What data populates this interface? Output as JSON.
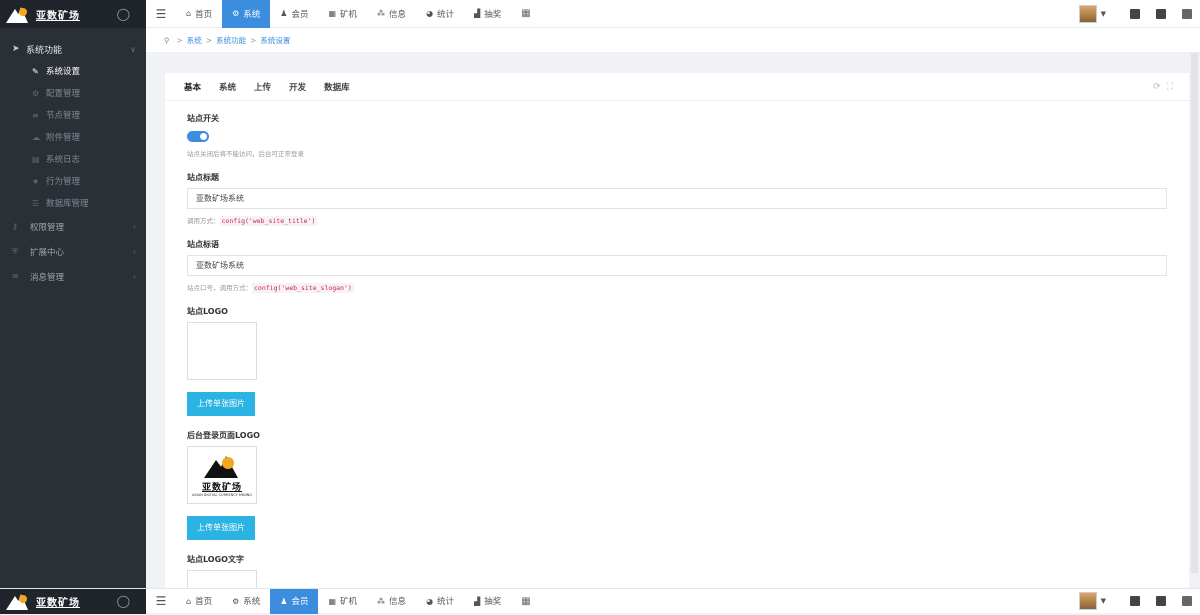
{
  "brand": {
    "name": "亚数矿场",
    "logo_tagline": "ASIAN DIGITAL CURRENCY MINING"
  },
  "sidebar": {
    "group_title": "系统功能",
    "sub_items": [
      {
        "label": "系统设置",
        "icon": "wrench-icon",
        "active": true
      },
      {
        "label": "配置管理",
        "icon": "gears-icon"
      },
      {
        "label": "节点管理",
        "icon": "list-icon"
      },
      {
        "label": "附件管理",
        "icon": "cloud-icon"
      },
      {
        "label": "系统日志",
        "icon": "file-icon"
      },
      {
        "label": "行为管理",
        "icon": "star-icon"
      },
      {
        "label": "数据库管理",
        "icon": "database-icon"
      }
    ],
    "top_items": [
      {
        "label": "权限管理",
        "icon": "key-icon"
      },
      {
        "label": "扩展中心",
        "icon": "shield-icon"
      },
      {
        "label": "消息管理",
        "icon": "chat-icon"
      }
    ]
  },
  "topnav": {
    "items": [
      {
        "label": "首页",
        "icon": "home-icon"
      },
      {
        "label": "系统",
        "icon": "gear-icon"
      },
      {
        "label": "会员",
        "icon": "user-icon"
      },
      {
        "label": "矿机",
        "icon": "windows-icon"
      },
      {
        "label": "信息",
        "icon": "sitemap-icon"
      },
      {
        "label": "统计",
        "icon": "pie-icon"
      },
      {
        "label": "抽奖",
        "icon": "chart-icon"
      }
    ],
    "active_index": 1
  },
  "bottomnav": {
    "active_index": 2
  },
  "breadcrumb": [
    "系统",
    "系统功能",
    "系统设置"
  ],
  "tabs": [
    "基本",
    "系统",
    "上传",
    "开发",
    "数据库"
  ],
  "form": {
    "site_switch": {
      "label": "站点开关",
      "enabled": true,
      "help": "站点关闭后将不能访问，后台可正常登录"
    },
    "site_title": {
      "label": "站点标题",
      "value": "亚数矿场系统",
      "help_prefix": "调用方式：",
      "help_code": "config('web_site_title')"
    },
    "site_slogan": {
      "label": "站点标语",
      "value": "亚数矿场系统",
      "help_prefix": "站点口号，调用方式：",
      "help_code": "config('web_site_slogan')"
    },
    "site_logo": {
      "label": "站点LOGO",
      "upload_label": "上传单张图片"
    },
    "admin_logo": {
      "label": "后台登录页面LOGO",
      "upload_label": "上传单张图片"
    },
    "logo_text": {
      "label": "站点LOGO文字"
    }
  },
  "colors": {
    "primary": "#3c8dde",
    "upload": "#2bb3e3",
    "sidebar": "#2b3037"
  }
}
